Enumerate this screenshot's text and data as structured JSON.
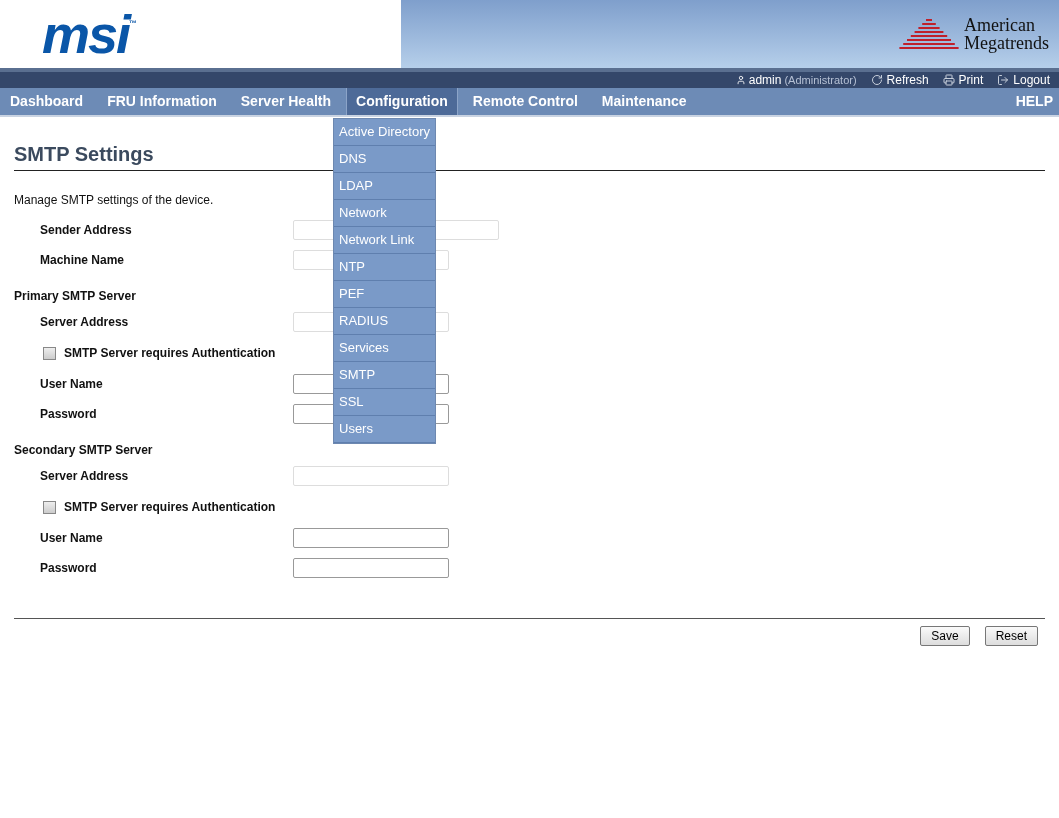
{
  "header": {
    "brand_logo": "msi",
    "trademark": "™",
    "vendor_logo": [
      "American",
      "Megatrends"
    ]
  },
  "user_bar": {
    "user": "admin",
    "role": "(Administrator)",
    "links": [
      {
        "kind": "refresh",
        "label": "Refresh"
      },
      {
        "kind": "print",
        "label": "Print"
      },
      {
        "kind": "logout",
        "label": "Logout"
      }
    ]
  },
  "nav": {
    "items": [
      {
        "label": "Dashboard",
        "selected": false
      },
      {
        "label": "FRU Information",
        "selected": false
      },
      {
        "label": "Server Health",
        "selected": false
      },
      {
        "label": "Configuration",
        "selected": true
      },
      {
        "label": "Remote Control",
        "selected": false
      },
      {
        "label": "Maintenance",
        "selected": false
      }
    ],
    "help": "HELP"
  },
  "dropdown": {
    "items": [
      "Active Directory",
      "DNS",
      "LDAP",
      "Network",
      "Network Link",
      "NTP",
      "PEF",
      "RADIUS",
      "Services",
      "SMTP",
      "SSL",
      "Users"
    ]
  },
  "page": {
    "title": "SMTP Settings",
    "description": "Manage SMTP settings of the device."
  },
  "form": [
    {
      "kind": "field",
      "label": "Sender Address",
      "disabled": true,
      "wide": true
    },
    {
      "kind": "field",
      "label": "Machine Name",
      "disabled": true,
      "wide": false
    },
    {
      "kind": "section",
      "label": "Primary SMTP Server"
    },
    {
      "kind": "field",
      "label": "Server Address",
      "disabled": true,
      "wide": false
    },
    {
      "kind": "checkbox",
      "label": "SMTP Server requires Authentication",
      "checked": false
    },
    {
      "kind": "field",
      "label": "User Name",
      "disabled": false,
      "wide": false
    },
    {
      "kind": "field",
      "label": "Password",
      "disabled": false,
      "wide": false
    },
    {
      "kind": "section",
      "label": "Secondary SMTP Server"
    },
    {
      "kind": "field",
      "label": "Server Address",
      "disabled": true,
      "wide": false
    },
    {
      "kind": "checkbox",
      "label": "SMTP Server requires Authentication",
      "checked": false
    },
    {
      "kind": "field",
      "label": "User Name",
      "disabled": false,
      "wide": false
    },
    {
      "kind": "field",
      "label": "Password",
      "disabled": false,
      "wide": false
    }
  ],
  "buttons": [
    "Save",
    "Reset"
  ]
}
